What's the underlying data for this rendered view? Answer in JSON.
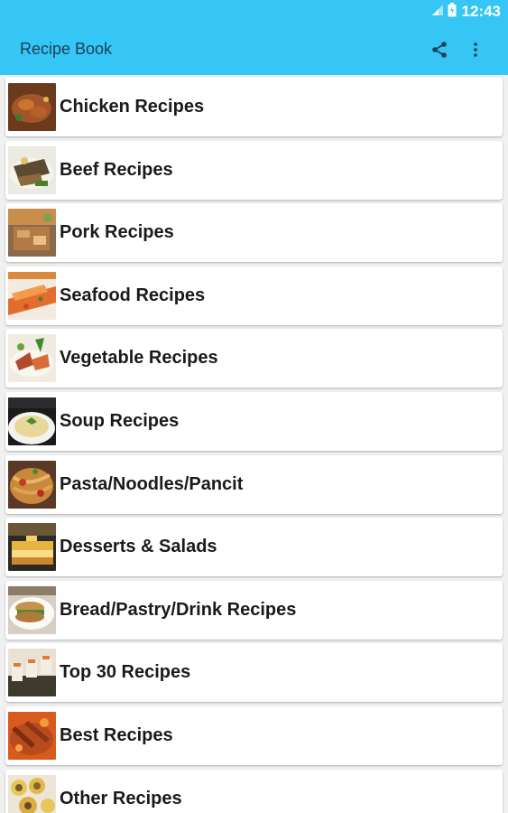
{
  "status_bar": {
    "time": "12:43",
    "icons": [
      "signal-icon",
      "battery-icon"
    ]
  },
  "toolbar": {
    "title": "Recipe Book",
    "actions": [
      "share-icon",
      "more-vert-icon"
    ]
  },
  "categories": [
    {
      "label": "Chicken Recipes",
      "icon": "chicken-dish-thumbnail"
    },
    {
      "label": "Beef Recipes",
      "icon": "beef-dish-thumbnail"
    },
    {
      "label": "Pork Recipes",
      "icon": "pork-dish-thumbnail"
    },
    {
      "label": "Seafood Recipes",
      "icon": "seafood-dish-thumbnail"
    },
    {
      "label": "Vegetable Recipes",
      "icon": "vegetable-dish-thumbnail"
    },
    {
      "label": "Soup Recipes",
      "icon": "soup-bowl-thumbnail"
    },
    {
      "label": "Pasta/Noodles/Pancit",
      "icon": "pasta-dish-thumbnail"
    },
    {
      "label": "Desserts & Salads",
      "icon": "dessert-cake-thumbnail"
    },
    {
      "label": "Bread/Pastry/Drink Recipes",
      "icon": "bread-pastry-thumbnail"
    },
    {
      "label": "Top 30 Recipes",
      "icon": "sushi-rolls-thumbnail"
    },
    {
      "label": "Best Recipes",
      "icon": "roast-dish-thumbnail"
    },
    {
      "label": "Other Recipes",
      "icon": "rolls-platter-thumbnail"
    }
  ],
  "colors": {
    "app_bar": "#35c6f6",
    "title_text": "#1f3f55",
    "list_background": "#f1f1f1",
    "card_background": "#ffffff"
  }
}
